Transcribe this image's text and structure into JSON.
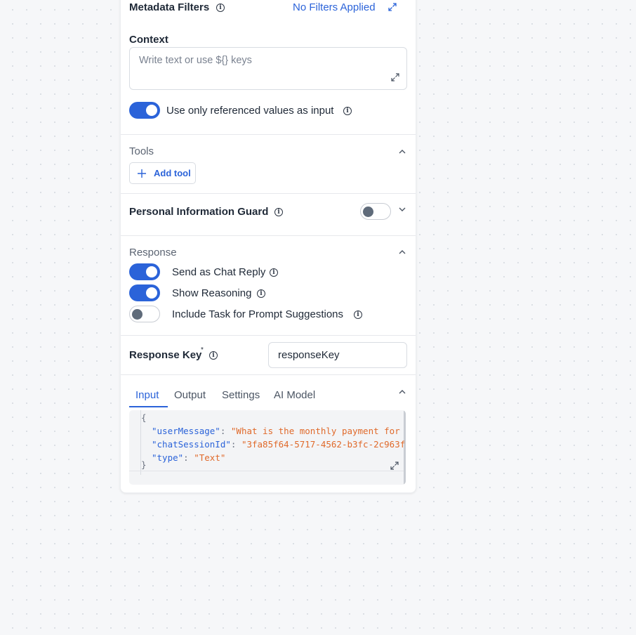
{
  "metadata": {
    "label": "Metadata Filters",
    "filters_link": "No Filters Applied"
  },
  "context": {
    "label": "Context",
    "placeholder": "Write text or use ${} keys",
    "value": ""
  },
  "referenced_values": {
    "label": "Use only referenced values as input",
    "enabled": true
  },
  "tools": {
    "label": "Tools",
    "add_label": "Add tool"
  },
  "pii_guard": {
    "label": "Personal Information Guard",
    "enabled": false
  },
  "response": {
    "label": "Response",
    "options": [
      {
        "label": "Send as Chat Reply",
        "enabled": true
      },
      {
        "label": "Show Reasoning",
        "enabled": true
      },
      {
        "label": "Include Task for Prompt Suggestions",
        "enabled": false
      }
    ]
  },
  "response_key": {
    "label": "Response Key",
    "required_mark": "*",
    "value": "responseKey"
  },
  "io_tabs": {
    "tabs": [
      "Input",
      "Output",
      "Settings",
      "AI Model"
    ],
    "active": "Input"
  },
  "input_json": {
    "open_brace": "{",
    "close_brace": "}",
    "lines": [
      {
        "key": "\"userMessage\"",
        "value": "\"What is the monthly payment for"
      },
      {
        "key": "\"chatSessionId\"",
        "value": "\"3fa85f64-5717-4562-b3fc-2c963f"
      },
      {
        "key": "\"type\"",
        "value": "\"Text\""
      }
    ]
  },
  "colors": {
    "accent": "#2b63d9",
    "string": "#e06a2b",
    "muted_heading": "#5b6472"
  }
}
